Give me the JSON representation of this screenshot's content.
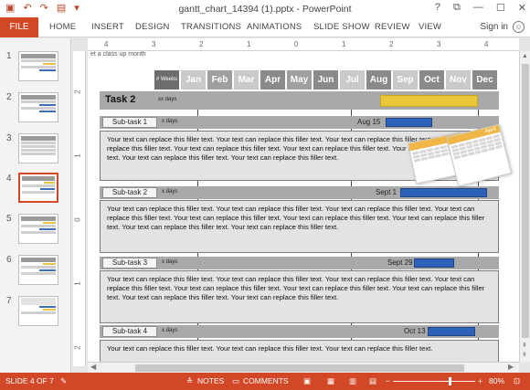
{
  "window": {
    "title": "gantt_chart_14394 (1).pptx - PowerPoint",
    "controls": [
      "?",
      "⧉",
      "—",
      "☐",
      "✕"
    ]
  },
  "qat": {
    "save_icon": "save-icon",
    "undo_icon": "undo-icon",
    "redo_icon": "redo-icon",
    "start_icon": "start-presentation-icon",
    "customize_icon": "customize-icon"
  },
  "ribbon": {
    "file": "FILE",
    "tabs": [
      "HOME",
      "INSERT",
      "DESIGN",
      "TRANSITIONS",
      "ANIMATIONS",
      "SLIDE SHOW",
      "REVIEW",
      "VIEW"
    ],
    "signin": "Sign in"
  },
  "thumbnails": {
    "numbers": [
      "1",
      "2",
      "3",
      "4",
      "5",
      "6",
      "7"
    ],
    "active": "4"
  },
  "ruler": {
    "marks": [
      "4",
      "3",
      "2",
      "1",
      "0",
      "1",
      "2",
      "3",
      "4"
    ]
  },
  "vruler": {
    "marks": [
      "2",
      "1",
      "0",
      "1",
      "2"
    ]
  },
  "slide": {
    "topnote": "et a class up month",
    "weeks_label": "# Weeks",
    "months": [
      "Jan",
      "Feb",
      "Mar",
      "Apr",
      "May",
      "Jun",
      "Jul",
      "Aug",
      "Sep",
      "Oct",
      "Nov",
      "Dec"
    ],
    "month_colors": [
      "#c9c9c9",
      "#9f9f9f",
      "#c9c9c9",
      "#8a8a8a",
      "#9f9f9f",
      "#8a8a8a",
      "#c9c9c9",
      "#8a8a8a",
      "#c9c9c9",
      "#8a8a8a",
      "#c9c9c9",
      "#8a8a8a"
    ],
    "task": {
      "label": "Task 2",
      "days": "xx days"
    },
    "subtasks": [
      {
        "label": "Sub-task 1",
        "days": "x days",
        "date": "Aug 15",
        "text": "Your text can replace this filler text. Your text can replace this filler text. Your text can replace this filler text. Your text can replace this filler text. Your text can replace this filler text. Your text can replace this filler text. Your text can replace this filler text. Your text can replace this filler text. Your text can replace this filler text."
      },
      {
        "label": "Sub-task 2",
        "days": "x days",
        "date": "Sept 1",
        "text": "Your text can replace this filler text. Your text can replace this filler text. Your text can replace this filler text. Your text can replace this filler text. Your text can replace this filler text. Your text can replace this filler text. Your text can replace this filler text. Your text can replace this filler text. Your text can replace this filler text."
      },
      {
        "label": "Sub-task 3",
        "days": "x days",
        "date": "Sept 29",
        "text": "Your text can replace this filler text. Your text can replace this filler text. Your text can replace this filler text. Your text can replace this filler text. Your text can replace this filler text. Your text can replace this filler text. Your text can replace this filler text. Your text can replace this filler text. Your text can replace this filler text."
      },
      {
        "label": "Sub-task 4",
        "days": "x days",
        "date": "Oct 13",
        "text": "Your text can replace this filler text. Your text can replace this filler text. Your text can replace this filler text."
      }
    ],
    "calendar_label": "April"
  },
  "status": {
    "slide_info": "SLIDE 4 OF 7",
    "notes": "NOTES",
    "comments": "COMMENTS",
    "zoom": "80%"
  },
  "colors": {
    "accent": "#d24726",
    "task_bar": "#e8c83a",
    "subtask_bar": "#2e62b8"
  }
}
